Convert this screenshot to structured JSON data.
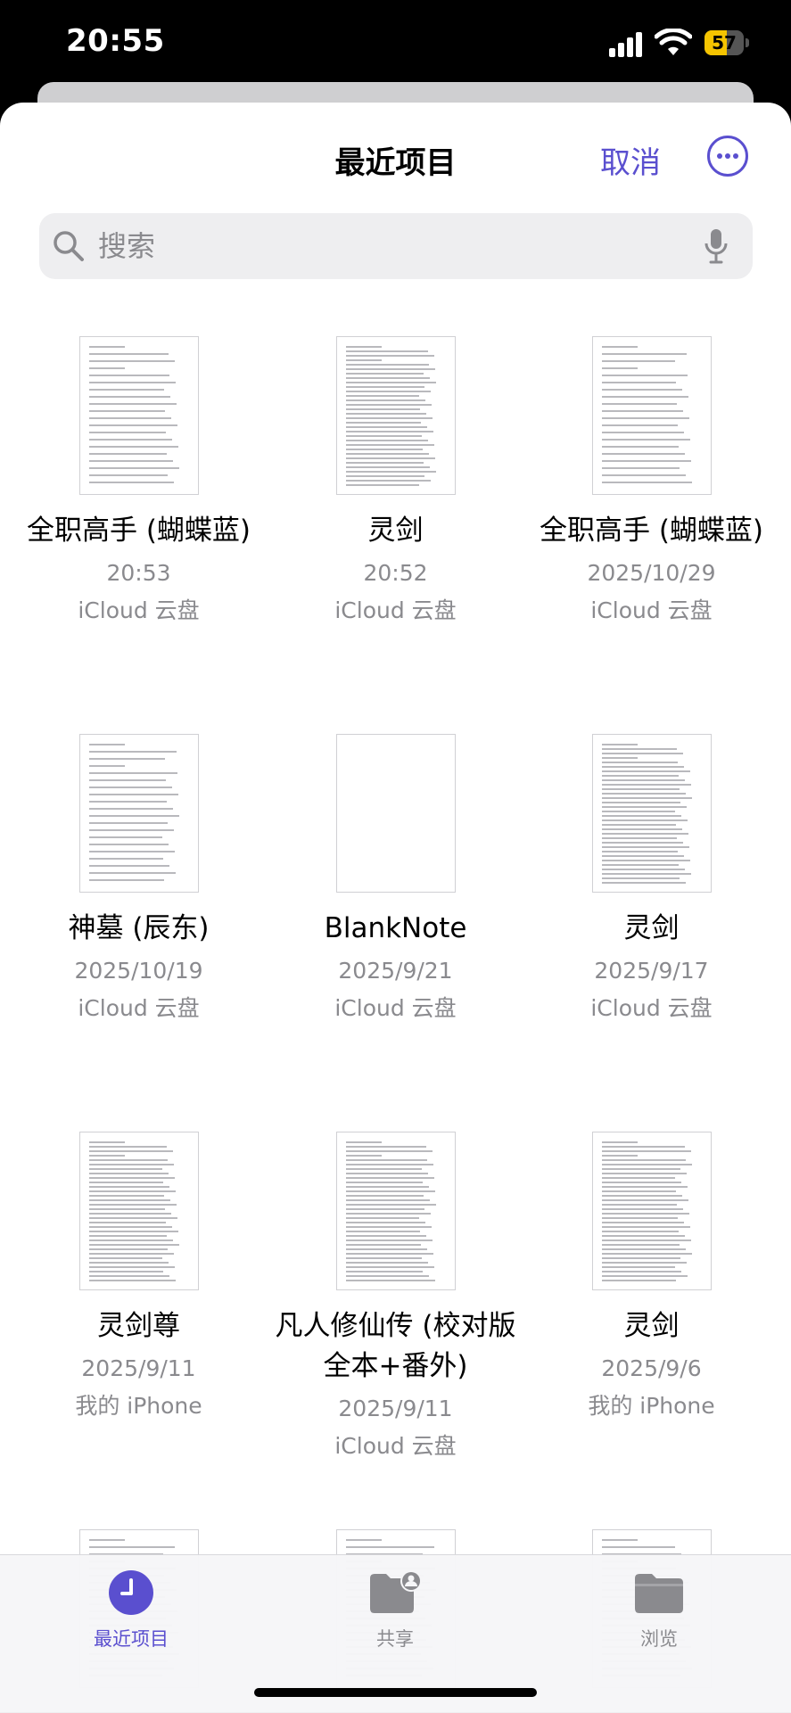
{
  "status_bar": {
    "time": "20:55",
    "battery": "57",
    "battery_level": 0.57
  },
  "header": {
    "title": "最近项目",
    "cancel_label": "取消"
  },
  "search": {
    "placeholder": "搜索"
  },
  "files": [
    {
      "name": "全职高手 (蝴蝶蓝)",
      "date": "20:53",
      "location": "iCloud 云盘",
      "thumb": "text"
    },
    {
      "name": "灵剑",
      "date": "20:52",
      "location": "iCloud 云盘",
      "thumb": "dense"
    },
    {
      "name": "全职高手 (蝴蝶蓝)",
      "date": "2025/10/29",
      "location": "iCloud 云盘",
      "thumb": "text"
    },
    {
      "name": "神墓 (辰东)",
      "date": "2025/10/19",
      "location": "iCloud 云盘",
      "thumb": "text"
    },
    {
      "name": "BlankNote",
      "date": "2025/9/21",
      "location": "iCloud 云盘",
      "thumb": "blank"
    },
    {
      "name": "灵剑",
      "date": "2025/9/17",
      "location": "iCloud 云盘",
      "thumb": "dense"
    },
    {
      "name": "灵剑尊",
      "date": "2025/9/11",
      "location": "我的 iPhone",
      "thumb": "dense"
    },
    {
      "name": "凡人修仙传 (校对版全本+番外)",
      "date": "2025/9/11",
      "location": "iCloud 云盘",
      "thumb": "dense"
    },
    {
      "name": "灵剑",
      "date": "2025/9/6",
      "location": "我的 iPhone",
      "thumb": "dense"
    },
    {
      "name": "",
      "date": "",
      "location": "",
      "thumb": "text"
    },
    {
      "name": "",
      "date": "",
      "location": "",
      "thumb": "text"
    },
    {
      "name": "",
      "date": "",
      "location": "",
      "thumb": "text"
    }
  ],
  "tabbar": {
    "items": [
      {
        "label": "最近项目",
        "icon": "clock-icon",
        "active": true
      },
      {
        "label": "共享",
        "icon": "shared-folder-icon",
        "active": false
      },
      {
        "label": "浏览",
        "icon": "folder-icon",
        "active": false
      }
    ]
  },
  "colors": {
    "accent": "#5a4fcf",
    "secondary_text": "#8a8a8e",
    "battery": "#f5c400"
  }
}
